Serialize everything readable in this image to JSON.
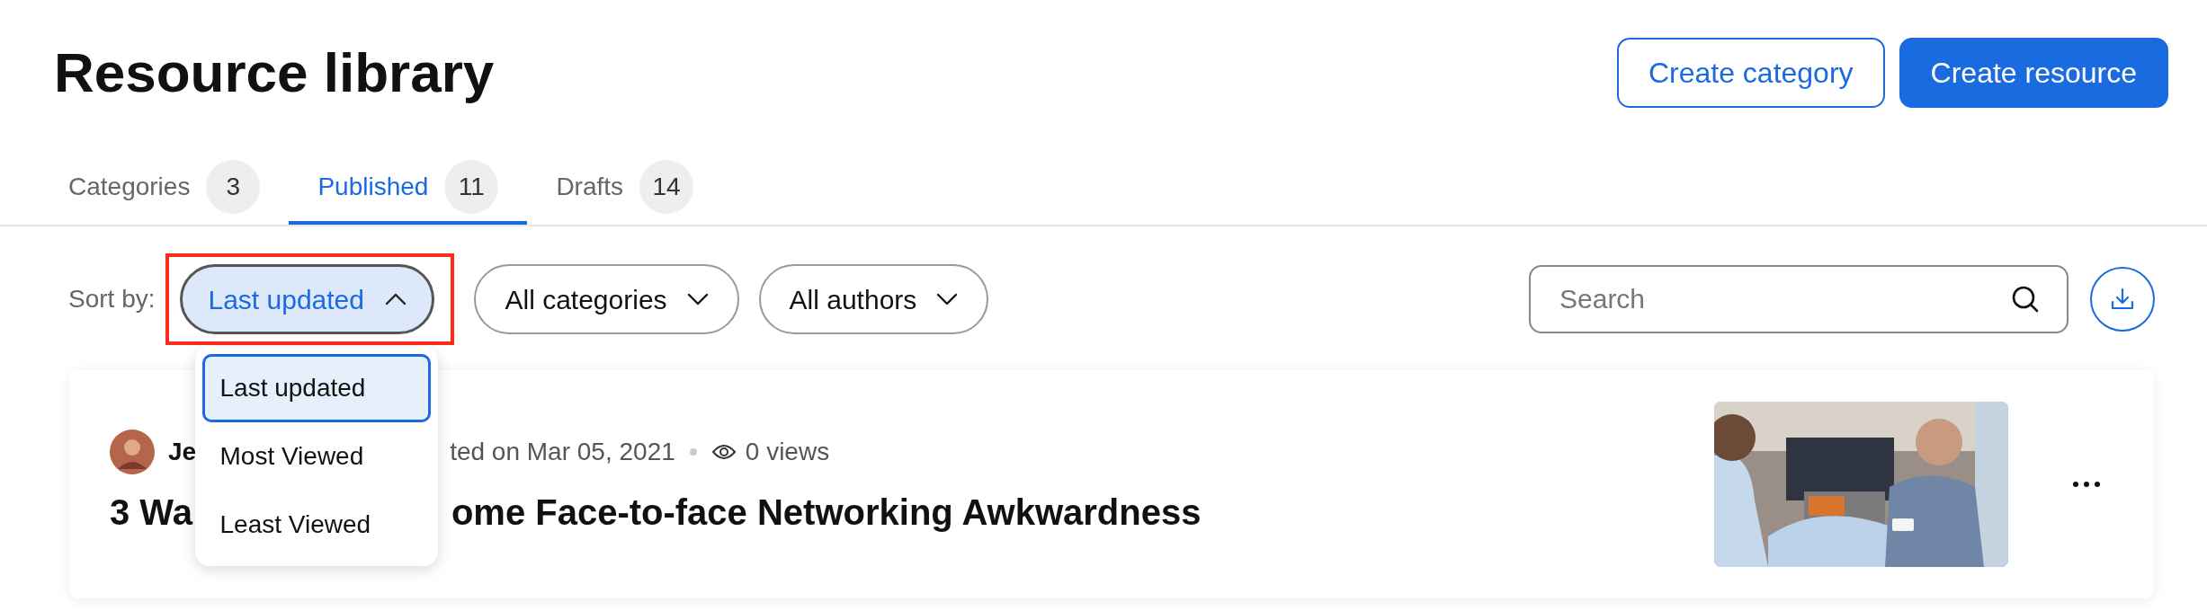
{
  "header": {
    "title": "Resource library",
    "buttons": [
      {
        "label": "Create category",
        "kind": "secondary"
      },
      {
        "label": "Create resource",
        "kind": "primary"
      }
    ]
  },
  "tabs": [
    {
      "label": "Categories",
      "count": "3",
      "selected": false
    },
    {
      "label": "Published",
      "count": "11",
      "selected": true
    },
    {
      "label": "Drafts",
      "count": "14",
      "selected": false
    }
  ],
  "filters": {
    "sort_label": "Sort by:",
    "sort": {
      "value": "Last updated",
      "expanded": true,
      "highlighted": true
    },
    "dropdowns": [
      {
        "value": "All categories",
        "expanded": false
      },
      {
        "value": "All authors",
        "expanded": false
      }
    ],
    "search": {
      "placeholder": "Search"
    }
  },
  "sort_menu": [
    {
      "label": "Last updated",
      "selected": true
    },
    {
      "label": "Most Viewed",
      "selected": false
    },
    {
      "label": "Least Viewed",
      "selected": false
    }
  ],
  "resources": [
    {
      "author": "Je",
      "meta": "ted on Mar 05, 2021",
      "views": "0 views",
      "title_start": "3 Wa",
      "title_end": "ome Face-to-face Networking Awkwardness"
    }
  ]
}
